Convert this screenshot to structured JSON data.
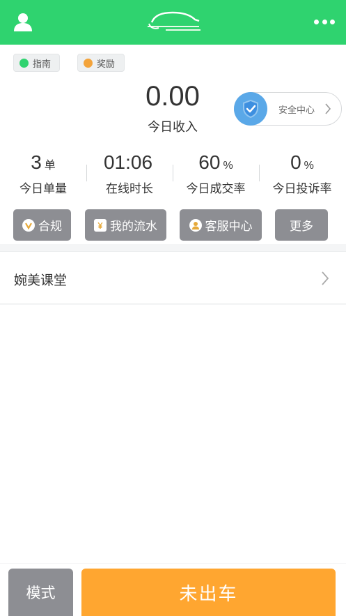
{
  "header": {
    "user_icon": "user-icon",
    "logo_icon": "car-logo-icon",
    "more_icon": "more-dots-icon",
    "accent": "#2fd36f"
  },
  "chips": {
    "guide": "指南",
    "reward": "奖励"
  },
  "income": {
    "value": "0.00",
    "label": "今日收入"
  },
  "safety": {
    "label": "安全中心",
    "icon": "shield-check-icon"
  },
  "stats": [
    {
      "value": "3",
      "unit": "单",
      "label": "今日单量"
    },
    {
      "value": "01:06",
      "unit": "",
      "label": "在线时长"
    },
    {
      "value": "60",
      "unit": "%",
      "label": "今日成交率"
    },
    {
      "value": "0",
      "unit": "%",
      "label": "今日投诉率"
    }
  ],
  "actions": [
    {
      "label": "合规",
      "icon": "compliance-v-icon"
    },
    {
      "label": "我的流水",
      "icon": "receipt-icon"
    },
    {
      "label": "客服中心",
      "icon": "support-agent-icon"
    },
    {
      "label": "更多",
      "icon": ""
    }
  ],
  "course": {
    "label": "婉美课堂"
  },
  "bottom": {
    "mode": "模式",
    "status": "未出车",
    "status_color": "#ffa630"
  }
}
